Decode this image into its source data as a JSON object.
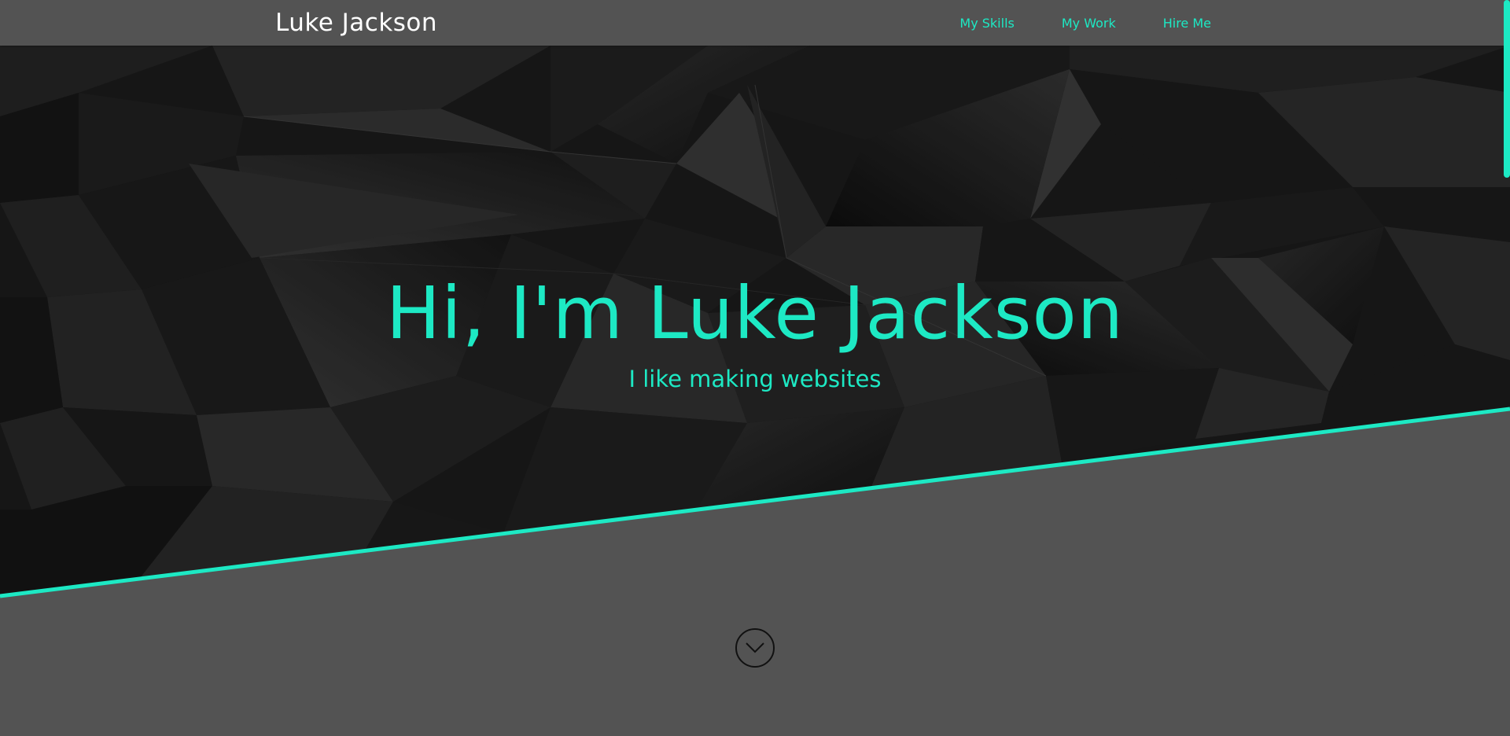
{
  "header": {
    "brand": "Luke Jackson",
    "nav": [
      {
        "label": "My Skills"
      },
      {
        "label": "My Work"
      },
      {
        "label": "Hire Me"
      }
    ]
  },
  "hero": {
    "title": "Hi, I'm Luke Jackson",
    "subtitle": "I like making websites"
  },
  "scroll_down": {
    "icon": "chevron-down-icon"
  },
  "colors": {
    "accent": "#1de9c4",
    "header_bg": "#535353",
    "page_bg": "#535353",
    "hero_bg": "#1a1a1a"
  }
}
